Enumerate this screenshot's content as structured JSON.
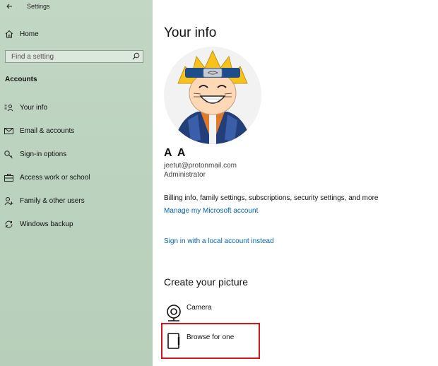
{
  "window": {
    "title": "Settings"
  },
  "sidebar": {
    "home_label": "Home",
    "search": {
      "placeholder": "Find a setting"
    },
    "section_title": "Accounts",
    "items": [
      {
        "label": "Your info",
        "icon": "person-card-icon"
      },
      {
        "label": "Email & accounts",
        "icon": "mail-icon"
      },
      {
        "label": "Sign-in options",
        "icon": "key-icon"
      },
      {
        "label": "Access work or school",
        "icon": "briefcase-icon"
      },
      {
        "label": "Family & other users",
        "icon": "person-add-icon"
      },
      {
        "label": "Windows backup",
        "icon": "sync-icon"
      }
    ]
  },
  "main": {
    "title": "Your info",
    "user": {
      "name": "A A",
      "email": "jeetut@protonmail.com",
      "role": "Administrator"
    },
    "billing_info": "Billing info, family settings, subscriptions, security settings, and more",
    "manage_account_link": "Manage my Microsoft account",
    "local_account_link": "Sign in with a local account instead",
    "create_picture": {
      "title": "Create your picture",
      "options": [
        {
          "label": "Camera",
          "icon": "camera-icon"
        },
        {
          "label": "Browse for one",
          "icon": "browse-file-icon"
        }
      ]
    }
  },
  "colors": {
    "link": "#0067b8",
    "highlight_border": "#d7141a",
    "sidebar_bg": "#bcd3bf"
  }
}
